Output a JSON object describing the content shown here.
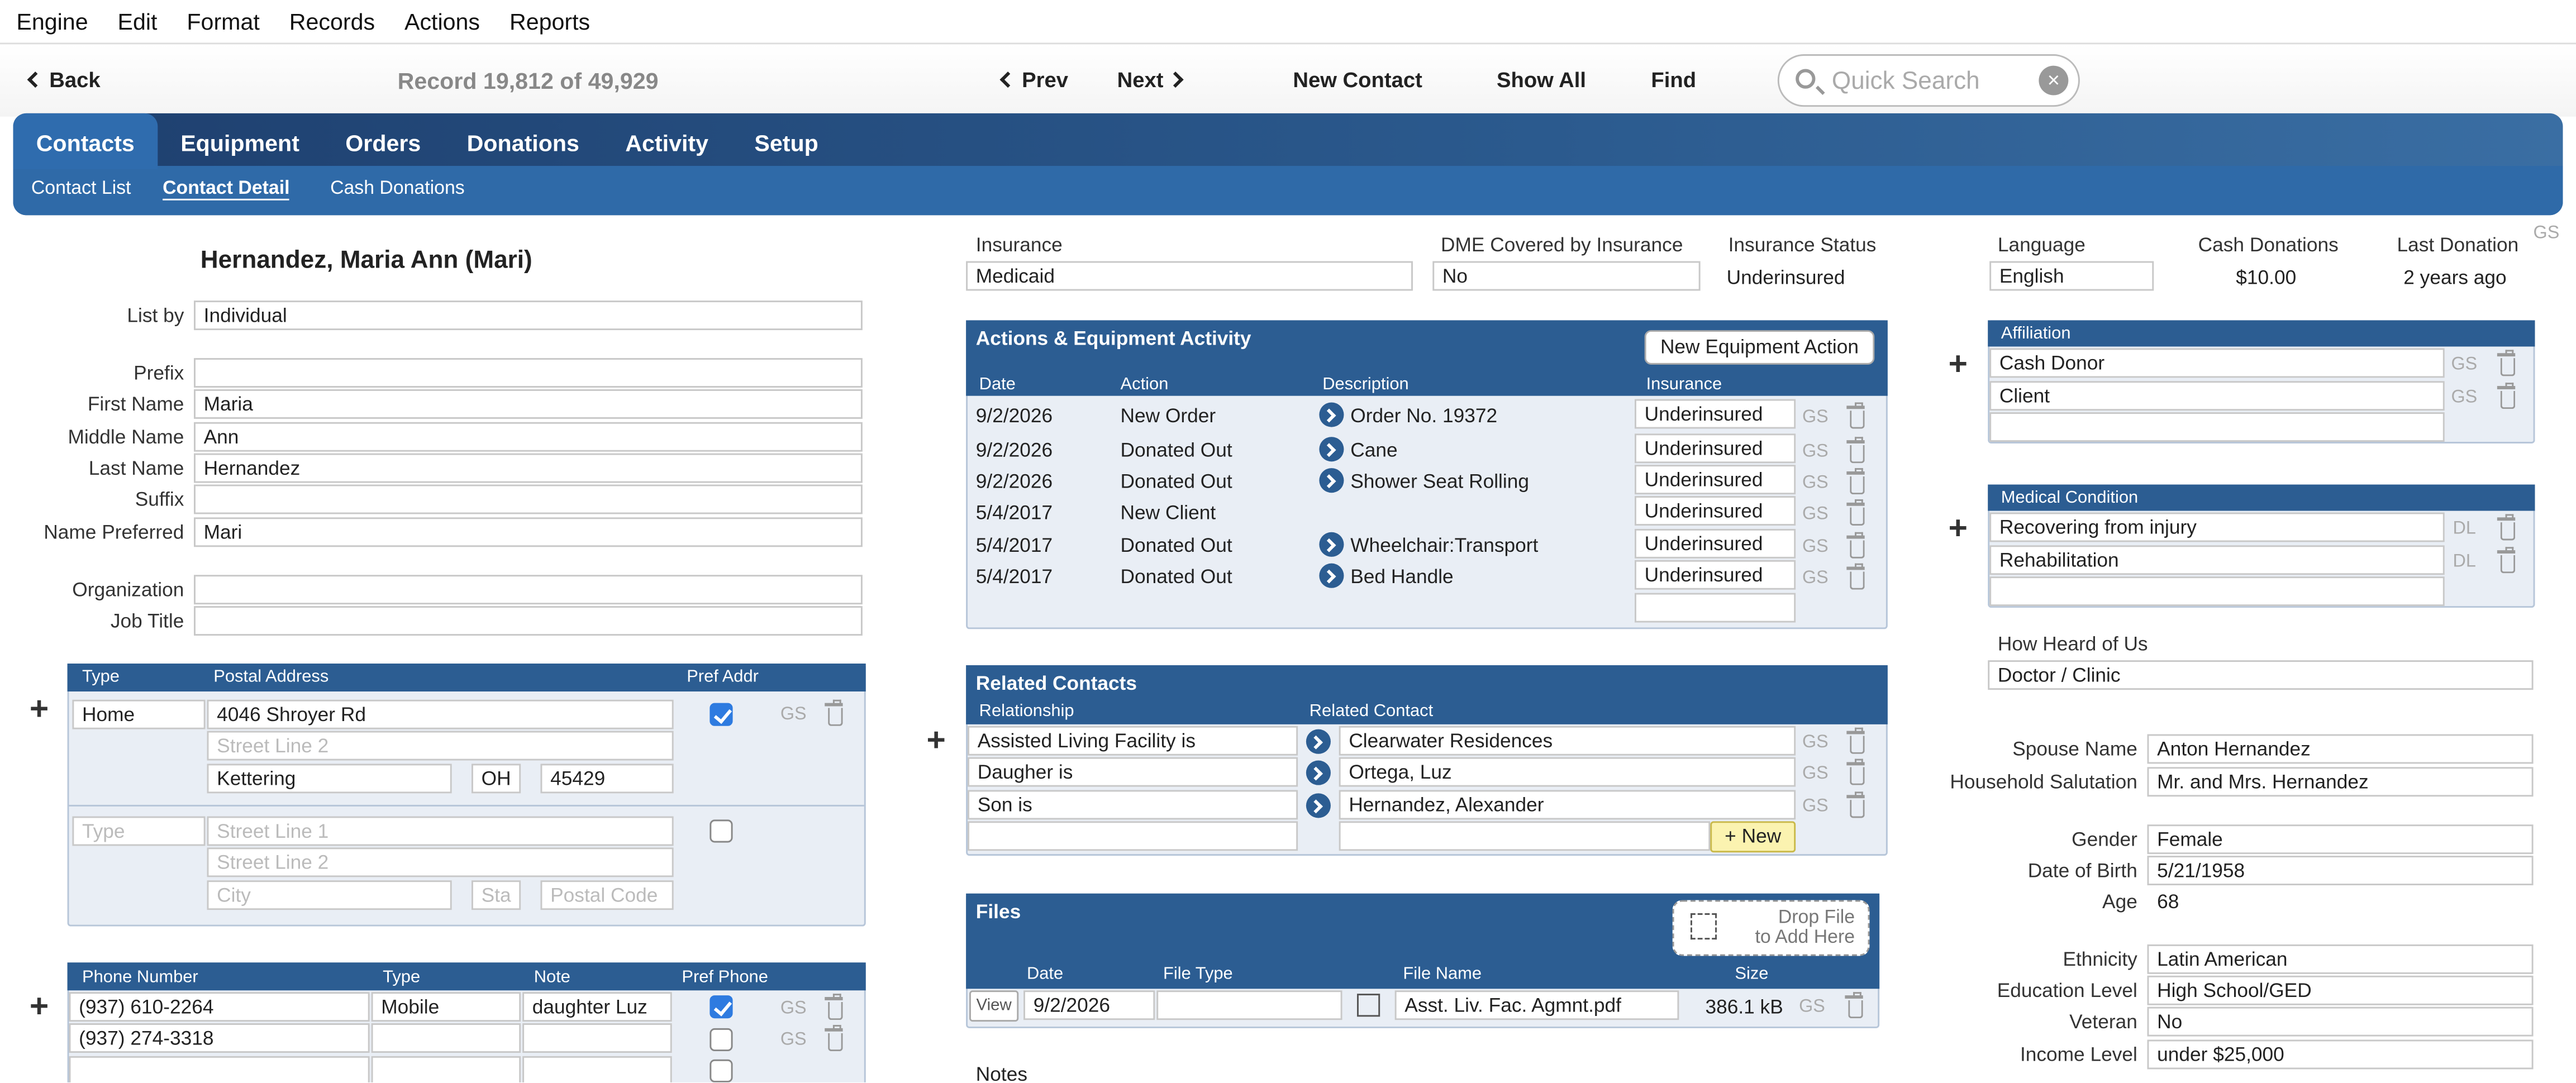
{
  "menu": [
    "Engine",
    "Edit",
    "Format",
    "Records",
    "Actions",
    "Reports"
  ],
  "toolbar": {
    "back": "Back",
    "record": "Record 19,812 of 49,929",
    "prev": "Prev",
    "next": "Next",
    "new_contact": "New Contact",
    "show_all": "Show All",
    "find": "Find",
    "search_placeholder": "Quick Search"
  },
  "tabs": [
    "Contacts",
    "Equipment",
    "Orders",
    "Donations",
    "Activity",
    "Setup"
  ],
  "subtabs": [
    "Contact List",
    "Contact Detail",
    "Cash Donations"
  ],
  "contact": {
    "title": "Hernandez, Maria Ann (Mari)",
    "list_by_label": "List by",
    "list_by": "Individual",
    "prefix_label": "Prefix",
    "prefix": "",
    "first_label": "First Name",
    "first": "Maria",
    "middle_label": "Middle Name",
    "middle": "Ann",
    "last_label": "Last Name",
    "last": "Hernandez",
    "suffix_label": "Suffix",
    "suffix": "",
    "pref_label": "Name Preferred",
    "pref": "Mari",
    "org_label": "Organization",
    "org": "",
    "job_label": "Job Title",
    "job": ""
  },
  "address": {
    "h_type": "Type",
    "h_addr": "Postal Address",
    "h_pref": "Pref Addr",
    "type": "Home",
    "line1": "4046 Shroyer Rd",
    "line2_ph": "Street Line 2",
    "city": "Kettering",
    "state": "OH",
    "zip": "45429",
    "gs": "GS",
    "new_type_ph": "Type",
    "new_line1_ph": "Street Line 1",
    "new_line2_ph": "Street Line 2",
    "new_city_ph": "City",
    "new_state_ph": "Sta",
    "new_zip_ph": "Postal Code"
  },
  "phones": {
    "h_num": "Phone Number",
    "h_type": "Type",
    "h_note": "Note",
    "h_pref": "Pref Phone",
    "rows": [
      {
        "num": "(937) 610-2264",
        "type": "Mobile",
        "note": "daughter Luz",
        "gs": "GS"
      },
      {
        "num": "(937) 274-3318",
        "type": "",
        "note": "",
        "gs": "GS"
      }
    ]
  },
  "insurance": {
    "label": "Insurance",
    "value": "Medicaid",
    "dme_label": "DME Covered by Insurance",
    "dme": "No",
    "status_label": "Insurance Status",
    "status": "Underinsured"
  },
  "actions": {
    "title": "Actions & Equipment Activity",
    "new_btn": "New Equipment Action",
    "h_date": "Date",
    "h_action": "Action",
    "h_desc": "Description",
    "h_ins": "Insurance",
    "rows": [
      {
        "date": "9/2/2026",
        "action": "New Order",
        "desc": "Order No. 19372",
        "ins": "Underinsured"
      },
      {
        "date": "9/2/2026",
        "action": "Donated Out",
        "desc": "Cane",
        "ins": "Underinsured"
      },
      {
        "date": "9/2/2026",
        "action": "Donated Out",
        "desc": "Shower Seat Rolling",
        "ins": "Underinsured"
      },
      {
        "date": "5/4/2017",
        "action": "New Client",
        "desc": "",
        "ins": "Underinsured"
      },
      {
        "date": "5/4/2017",
        "action": "Donated Out",
        "desc": "Wheelchair:Transport",
        "ins": "Underinsured"
      },
      {
        "date": "5/4/2017",
        "action": "Donated Out",
        "desc": "Bed Handle",
        "ins": "Underinsured"
      }
    ],
    "gs": "GS"
  },
  "related": {
    "title": "Related Contacts",
    "h_rel": "Relationship",
    "h_contact": "Related Contact",
    "new_btn": "+ New",
    "gs": "GS",
    "rows": [
      {
        "rel": "Assisted Living Facility is",
        "contact": "Clearwater Residences"
      },
      {
        "rel": "Daugher is",
        "contact": "Ortega, Luz"
      },
      {
        "rel": "Son is",
        "contact": "Hernandez, Alexander"
      }
    ]
  },
  "files": {
    "title": "Files",
    "drop": "Drop File",
    "drop2": "to Add Here",
    "h_date": "Date",
    "h_type": "File Type",
    "h_name": "File Name",
    "h_size": "Size",
    "view": "View",
    "date": "9/2/2026",
    "type": "",
    "name": "Asst. Liv. Fac. Agmnt.pdf",
    "size": "386.1 kB",
    "gs": "GS"
  },
  "notes_label": "Notes",
  "right": {
    "lang_label": "Language",
    "lang": "English",
    "cash_label": "Cash Donations",
    "cash": "$10.00",
    "last_label": "Last Donation",
    "last": "2 years ago",
    "corner_gs": "GS",
    "affiliation_title": "Affiliation",
    "affiliations": [
      {
        "name": "Cash Donor",
        "tag": "GS"
      },
      {
        "name": "Client",
        "tag": "GS"
      }
    ],
    "medical_title": "Medical Condition",
    "medical": [
      {
        "name": "Recovering from injury",
        "tag": "DL"
      },
      {
        "name": "Rehabilitation",
        "tag": "DL"
      }
    ],
    "heard_label": "How Heard of Us",
    "heard": "Doctor / Clinic",
    "spouse_label": "Spouse Name",
    "spouse": "Anton Hernandez",
    "salut_label": "Household Salutation",
    "salut": "Mr. and Mrs. Hernandez",
    "gender_label": "Gender",
    "gender": "Female",
    "dob_label": "Date of Birth",
    "dob": "5/21/1958",
    "age_label": "Age",
    "age": "68",
    "eth_label": "Ethnicity",
    "eth": "Latin American",
    "edu_label": "Education Level",
    "edu": "High School/GED",
    "vet_label": "Veteran",
    "vet": "No",
    "inc_label": "Income Level",
    "inc": "under $25,000"
  }
}
